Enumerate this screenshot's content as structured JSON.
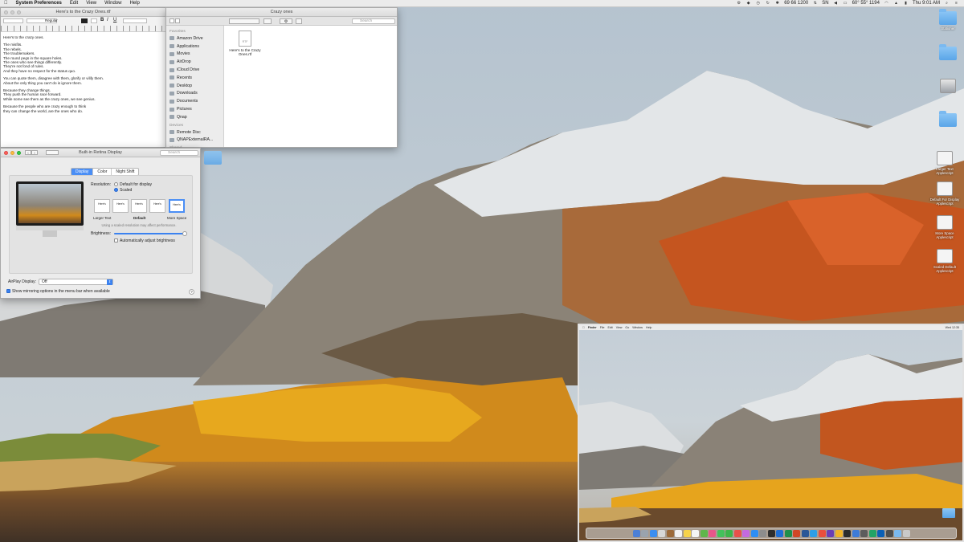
{
  "menubar": {
    "apple": "",
    "app_name": "System Preferences",
    "items": [
      "Edit",
      "View",
      "Window",
      "Help"
    ],
    "status": {
      "weather": "69 66 1200",
      "user_initials": "SN",
      "temps": "60° 55° 1194",
      "clock": "Thu 9:01 AM"
    }
  },
  "textedit": {
    "title": "Here's to the Crazy Ones.rtf",
    "style_label": "Regular",
    "paragraphs": [
      "Here's to the crazy ones.",
      "The misfits.\nThe rebels.\nThe troublemakers.\nThe round pegs in the square holes.\nThe ones who see things differently.\nThey're not fond of rules.\nAnd they have no respect for the status quo.",
      "You can quote them, disagree with them, glorify or vilify them.\nAbout the only thing you can't do is ignore them.",
      "Because they change things.\nThey push the human race forward.\nWhile some see them as the crazy ones, we see genius.",
      "Because the people who are crazy enough to think\nthey can change the world, are the ones who do."
    ]
  },
  "finder": {
    "title": "Crazy ones",
    "search_placeholder": "Search",
    "sidebar": {
      "favorites_header": "Favorites",
      "favorites": [
        "Amazon Drive",
        "Applications",
        "Movies",
        "AirDrop",
        "iCloud Drive",
        "Recents",
        "Desktop",
        "Downloads",
        "Documents",
        "Pictures",
        "Qnap"
      ],
      "devices_header": "Devices",
      "devices": [
        "Remote Disc",
        "QNAPExternalRA..."
      ],
      "shared_header": "Shared"
    },
    "file": {
      "name": "Here's to the Crazy Ones.rtf",
      "ext": "RTF"
    }
  },
  "display_prefs": {
    "title": "Built-in Retina Display",
    "search_placeholder": "Search",
    "tabs": [
      "Display",
      "Color",
      "Night Shift"
    ],
    "active_tab": "Display",
    "resolution_label": "Resolution:",
    "resolution_options": [
      "Default for display",
      "Scaled"
    ],
    "resolution_selected": "Scaled",
    "scale_labels": [
      "Larger Text",
      "Default",
      "More Space"
    ],
    "scale_sample": "Here's",
    "perf_note": "Using a scaled resolution may affect performance.",
    "brightness_label": "Brightness:",
    "brightness_value": 0.97,
    "auto_brightness": "Automatically adjust brightness",
    "airplay_label": "AirPlay Display:",
    "airplay_value": "Off",
    "mirroring_option": "Show mirroring options in the menu bar when available",
    "help": "?"
  },
  "desktop_icons": [
    "Stationer",
    "",
    "",
    "",
    "Larger Text Applescript",
    "Default For Display Applescript",
    "More Space Applescript",
    "Scaled Default Applescript"
  ],
  "inset": {
    "menu": [
      "Finder",
      "File",
      "Edit",
      "View",
      "Go",
      "Window",
      "Help"
    ],
    "clock": "Wed 12:35"
  },
  "colors": {
    "accent": "#4a8ef5",
    "traffic_close": "#fc605c",
    "traffic_min": "#fdbc40",
    "traffic_zoom": "#34c84a"
  }
}
